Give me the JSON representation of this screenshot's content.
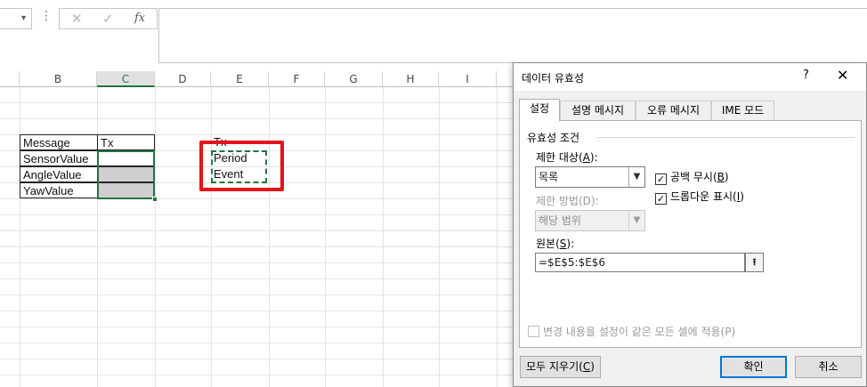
{
  "formula_bar": {
    "fx_label": "fx",
    "cancel_glyph": "✕",
    "enter_glyph": "✓",
    "dots": "⋮"
  },
  "columns": [
    "B",
    "C",
    "D",
    "E",
    "F",
    "G",
    "H",
    "I"
  ],
  "cells": {
    "message": "Message",
    "tx_c": "Tx",
    "sensor": "SensorValue",
    "angle": "AngleValue",
    "yaw": "YawValue",
    "tx_e": "Tx",
    "period": "Period",
    "event": "Event"
  },
  "dialog": {
    "title": "데이터 유효성",
    "help": "?",
    "close": "✕",
    "tabs": [
      "설정",
      "설명 메시지",
      "오류 메시지",
      "IME 모드"
    ],
    "group_title": "유효성 조건",
    "allow_label": "제한 대상(",
    "allow_key": "A",
    "allow_value": "목록",
    "data_label": "제한 방법(D):",
    "data_value": "해당 범위",
    "ignore_blank": "공백 무시(",
    "ignore_blank_key": "B",
    "dropdown": "드롭다운 표시(",
    "dropdown_key": "I",
    "source_label": "원본(",
    "source_key": "S",
    "source_value": "=$E$5:$E$6",
    "apply_all": "변경 내용을 설정이 같은 모든 셀에 적용(P)",
    "clear_all": "모두 지우기(",
    "clear_all_key": "C",
    "ok": "확인",
    "cancel": "취소"
  },
  "colors": {
    "excel_green": "#217346",
    "highlight_red": "#e3131c",
    "focus_blue": "#0078d7"
  }
}
